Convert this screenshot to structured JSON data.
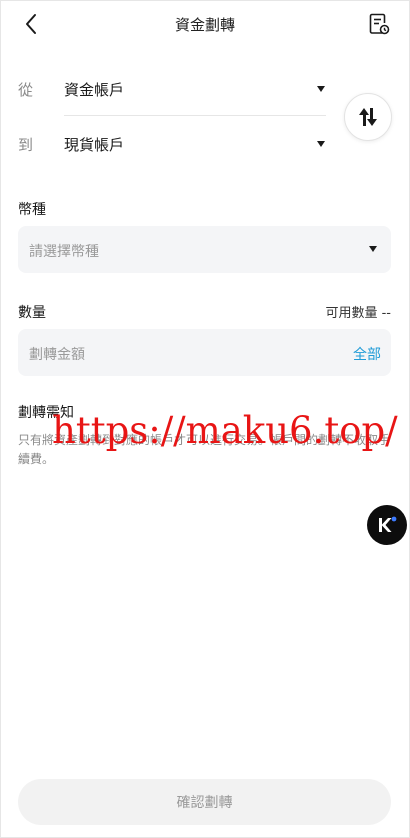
{
  "header": {
    "title": "資金劃轉",
    "back_icon": "chevron-left-icon",
    "history_icon": "document-history-icon"
  },
  "transfer": {
    "from_label": "從",
    "from_value": "資金帳戶",
    "to_label": "到",
    "to_value": "現貨帳戶",
    "swap_icon": "swap-arrows-icon"
  },
  "currency": {
    "label": "幣種",
    "placeholder": "請選擇幣種"
  },
  "amount": {
    "label": "數量",
    "available_label": "可用數量 --",
    "placeholder": "劃轉金額",
    "all_label": "全部"
  },
  "notice": {
    "title": "劃轉需知",
    "text": "只有將資產劃轉到對應的帳戶才可以進行交易。帳戶間的劃轉不收取手續費。"
  },
  "watermark": {
    "text": "https://maku6.top/",
    "color": "#e81515"
  },
  "floating": {
    "icon": "k-logo-icon"
  },
  "footer": {
    "confirm_label": "確認劃轉"
  },
  "colors": {
    "accent": "#1f9bd7",
    "field_bg": "#f4f5f7",
    "button_disabled_bg": "#f2f2f2"
  }
}
